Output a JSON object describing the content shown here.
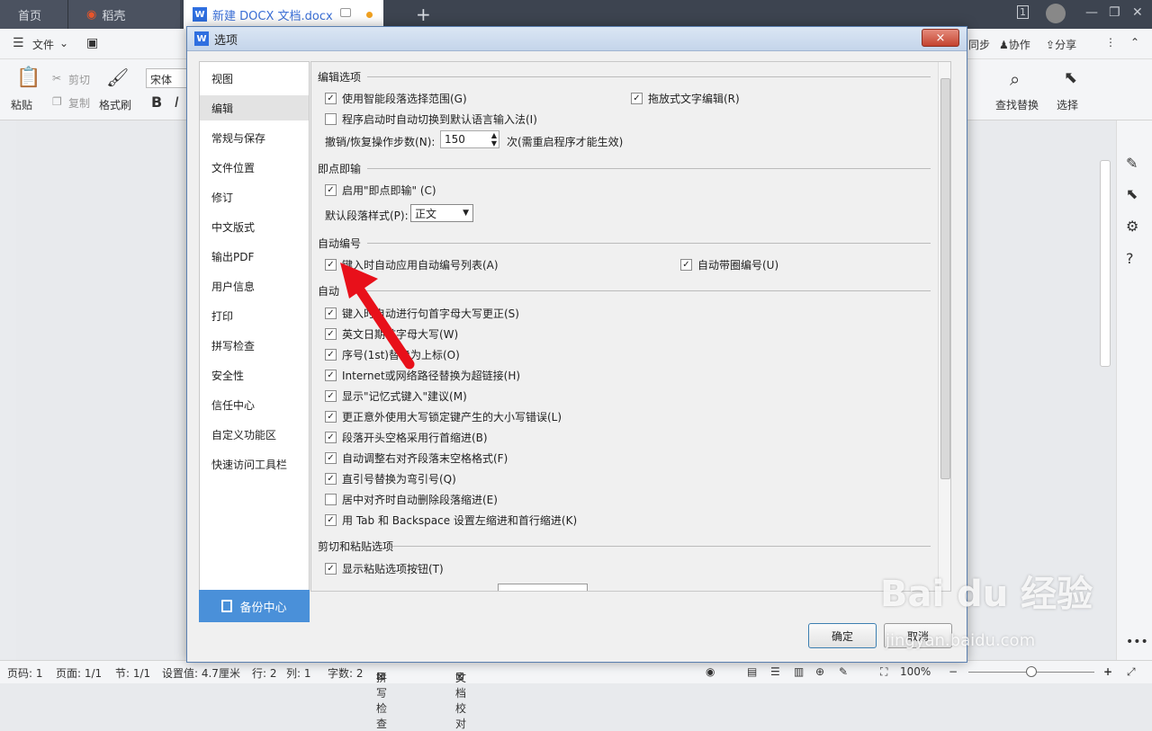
{
  "tabs": {
    "home": "首页",
    "daoke": "稻壳",
    "doc": "新建 DOCX 文档.docx",
    "plus": "+"
  },
  "menubar": {
    "file": "文件",
    "sync": "同步",
    "collab": "协作",
    "share": "分享"
  },
  "ribbon": {
    "paste": "粘贴",
    "cut": "剪切",
    "copy": "复制",
    "format_painter": "格式刷",
    "font": "宋体",
    "bold": "B",
    "italic": "I",
    "find_replace": "查找替换",
    "select": "选择"
  },
  "statusbar": {
    "page_no": "页码: 1",
    "pages": "页面: 1/1",
    "section": "节: 1/1",
    "setting": "设置值: 4.7厘米",
    "row": "行: 2",
    "col": "列: 1",
    "words": "字数: 2",
    "spellcheck": "拼写检查",
    "doc_check": "文档校对",
    "zoom": "100%"
  },
  "dialog": {
    "title": "选项",
    "close": "×",
    "nav": [
      {
        "label": "视图"
      },
      {
        "label": "编辑"
      },
      {
        "label": "常规与保存"
      },
      {
        "label": "文件位置"
      },
      {
        "label": "修订"
      },
      {
        "label": "中文版式"
      },
      {
        "label": "输出PDF"
      },
      {
        "label": "用户信息"
      },
      {
        "label": "打印"
      },
      {
        "label": "拼写检查"
      },
      {
        "label": "安全性"
      },
      {
        "label": "信任中心"
      },
      {
        "label": "自定义功能区"
      },
      {
        "label": "快速访问工具栏"
      }
    ],
    "backup": "备份中心",
    "sections": {
      "edit": "编辑选项",
      "click_type": "即点即输",
      "auto_number": "自动编号",
      "auto_correct": "自动",
      "cut_paste": "剪切和粘贴选项"
    },
    "options": {
      "smart_para": "使用智能段落选择范围(G)",
      "drag_edit": "拖放式文字编辑(R)",
      "auto_ime": "程序启动时自动切换到默认语言输入法(I)",
      "undo_label": "撤销/恢复操作步数(N):",
      "undo_value": "150",
      "undo_note": "次(需重启程序才能生效)",
      "enable_click": "启用\"即点即输\" (C)",
      "para_style_label": "默认段落样式(P):",
      "para_style_value": "正文",
      "auto_list": "键入时自动应用自动编号列表(A)",
      "circle_num": "自动带圈编号(U)",
      "ac1": "键入时自动进行句首字母大写更正(S)",
      "ac2": "英文日期首字母大写(W)",
      "ac3": "序号(1st)替换为上标(O)",
      "ac4": "Internet或网络路径替换为超链接(H)",
      "ac5": "显示\"记忆式键入\"建议(M)",
      "ac6": "更正意外使用大写锁定键产生的大小写错误(L)",
      "ac7": "段落开头空格采用行首缩进(B)",
      "ac8": "自动调整右对齐段落末空格格式(F)",
      "ac9": "直引号替换为弯引号(Q)",
      "ac10": "居中对齐时自动删除段落缩进(E)",
      "ac11": "用 Tab 和 Backspace 设置左缩进和首行缩进(K)",
      "show_paste": "显示粘贴选项按钮(T)"
    },
    "ok": "确定",
    "cancel": "取消"
  },
  "watermark": {
    "main": "Bai du 经验",
    "sub": "jingyan.baidu.com"
  }
}
